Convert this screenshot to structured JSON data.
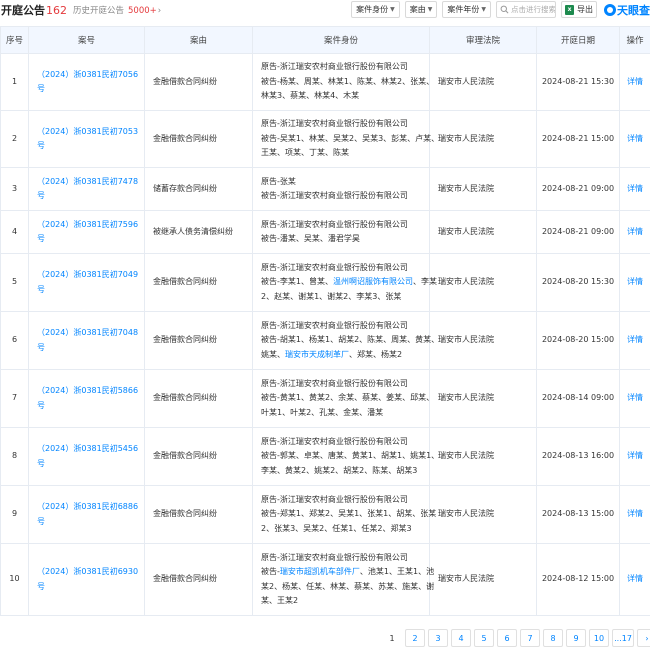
{
  "header": {
    "title": "开庭公告",
    "count": "162",
    "history_label": "历史开庭公告",
    "history_count": "5000+",
    "history_arrow": "›"
  },
  "toolbar": {
    "filter_identity": "案件身份",
    "filter_cause": "案由",
    "filter_year": "案件年份",
    "search_placeholder": "点击进行搜索",
    "export_label": "导出",
    "brand": "天眼查"
  },
  "table": {
    "columns": [
      "序号",
      "案号",
      "案由",
      "案件身份",
      "审理法院",
      "开庭日期",
      "操作"
    ],
    "rows": [
      {
        "idx": "1",
        "case_no": "（2024）浙0381民初7056号",
        "cause": "金融借款合同纠纷",
        "parties": [
          [
            {
              "t": "原告-浙江瑞安农村商业银行股份有限公司"
            }
          ],
          [
            {
              "t": "被告-杨某、周某、林某1、陈某、林某2、张某、"
            }
          ],
          [
            {
              "t": "林某3、蔡某、林某4、木某"
            }
          ]
        ],
        "court": "瑞安市人民法院",
        "date": "2024-08-21 15:30",
        "op": "详情"
      },
      {
        "idx": "2",
        "case_no": "（2024）浙0381民初7053号",
        "cause": "金融借款合同纠纷",
        "parties": [
          [
            {
              "t": "原告-浙江瑞安农村商业银行股份有限公司"
            }
          ],
          [
            {
              "t": "被告-吴某1、林某、吴某2、吴某3、彭某、卢某、"
            }
          ],
          [
            {
              "t": "王某、项某、丁某、陈某"
            }
          ]
        ],
        "court": "瑞安市人民法院",
        "date": "2024-08-21 15:00",
        "op": "详情"
      },
      {
        "idx": "3",
        "case_no": "（2024）浙0381民初7478号",
        "cause": "储蓄存款合同纠纷",
        "parties": [
          [
            {
              "t": "原告-张某"
            }
          ],
          [
            {
              "t": "被告-浙江瑞安农村商业银行股份有限公司"
            }
          ]
        ],
        "court": "瑞安市人民法院",
        "date": "2024-08-21 09:00",
        "op": "详情"
      },
      {
        "idx": "4",
        "case_no": "（2024）浙0381民初7596号",
        "cause": "被继承人债务清偿纠纷",
        "parties": [
          [
            {
              "t": "原告-浙江瑞安农村商业银行股份有限公司"
            }
          ],
          [
            {
              "t": "被告-潘某、吴某、潘君学昊"
            }
          ]
        ],
        "court": "瑞安市人民法院",
        "date": "2024-08-21 09:00",
        "op": "详情"
      },
      {
        "idx": "5",
        "case_no": "（2024）浙0381民初7049号",
        "cause": "金融借款合同纠纷",
        "parties": [
          [
            {
              "t": "原告-浙江瑞安农村商业银行股份有限公司"
            }
          ],
          [
            {
              "t": "被告-李某1、曾某、"
            },
            {
              "t": "温州啊诏服饰有限公司",
              "link": true
            },
            {
              "t": "、李某"
            }
          ],
          [
            {
              "t": "2、赵某、谢某1、谢某2、李某3、张某"
            }
          ]
        ],
        "court": "瑞安市人民法院",
        "date": "2024-08-20 15:30",
        "op": "详情"
      },
      {
        "idx": "6",
        "case_no": "（2024）浙0381民初7048号",
        "cause": "金融借款合同纠纷",
        "parties": [
          [
            {
              "t": "原告-浙江瑞安农村商业银行股份有限公司"
            }
          ],
          [
            {
              "t": "被告-胡某1、杨某1、胡某2、陈某、周某、黄某、"
            }
          ],
          [
            {
              "t": "姚某、"
            },
            {
              "t": "瑞安市天成制革厂",
              "link": true
            },
            {
              "t": "、郑某、杨某2"
            }
          ]
        ],
        "court": "瑞安市人民法院",
        "date": "2024-08-20 15:00",
        "op": "详情"
      },
      {
        "idx": "7",
        "case_no": "（2024）浙0381民初5866号",
        "cause": "金融借款合同纠纷",
        "parties": [
          [
            {
              "t": "原告-浙江瑞安农村商业银行股份有限公司"
            }
          ],
          [
            {
              "t": "被告-黄某1、黄某2、余某、蔡某、姜某、邱某、"
            }
          ],
          [
            {
              "t": "叶某1、叶某2、孔某、金某、潘某"
            }
          ]
        ],
        "court": "瑞安市人民法院",
        "date": "2024-08-14 09:00",
        "op": "详情"
      },
      {
        "idx": "8",
        "case_no": "（2024）浙0381民初5456号",
        "cause": "金融借款合同纠纷",
        "parties": [
          [
            {
              "t": "原告-浙江瑞安农村商业银行股份有限公司"
            }
          ],
          [
            {
              "t": "被告-郭某、卓某、唐某、黄某1、胡某1、姚某1、"
            }
          ],
          [
            {
              "t": "李某、黄某2、姚某2、胡某2、陈某、胡某3"
            }
          ]
        ],
        "court": "瑞安市人民法院",
        "date": "2024-08-13 16:00",
        "op": "详情"
      },
      {
        "idx": "9",
        "case_no": "（2024）浙0381民初6886号",
        "cause": "金融借款合同纠纷",
        "parties": [
          [
            {
              "t": "原告-浙江瑞安农村商业银行股份有限公司"
            }
          ],
          [
            {
              "t": "被告-郑某1、郑某2、吴某1、张某1、胡某、张某"
            }
          ],
          [
            {
              "t": "2、张某3、吴某2、任某1、任某2、郑某3"
            }
          ]
        ],
        "court": "瑞安市人民法院",
        "date": "2024-08-13 15:00",
        "op": "详情"
      },
      {
        "idx": "10",
        "case_no": "（2024）浙0381民初6930号",
        "cause": "金融借款合同纠纷",
        "parties": [
          [
            {
              "t": "原告-浙江瑞安农村商业银行股份有限公司"
            }
          ],
          [
            {
              "t": "被告-"
            },
            {
              "t": "瑞安市超凯机车部件厂",
              "link": true
            },
            {
              "t": "、池某1、王某1、池"
            }
          ],
          [
            {
              "t": "某2、杨某、任某、林某、蔡某、苏某、施某、谢"
            }
          ],
          [
            {
              "t": "某、王某2"
            }
          ]
        ],
        "court": "瑞安市人民法院",
        "date": "2024-08-12 15:00",
        "op": "详情"
      }
    ]
  },
  "pagination": {
    "pages": [
      "1",
      "2",
      "3",
      "4",
      "5",
      "6",
      "7",
      "8",
      "9",
      "10",
      "...17",
      "›"
    ],
    "current": "1"
  }
}
